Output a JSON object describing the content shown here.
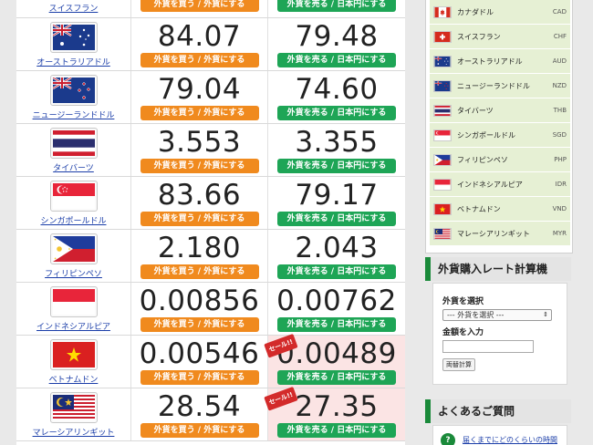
{
  "buttons": {
    "buy": "外貨を買う / 外貨にする",
    "sell": "外貨を売る / 日本円にする"
  },
  "sale_badge": "セール!!",
  "rates": [
    {
      "name": "スイスフラン",
      "flag": "switzerland-flag",
      "buy": "",
      "sell": ""
    },
    {
      "name": "オーストラリアドル",
      "flag": "australia-flag",
      "buy": "84.07",
      "sell": "79.48"
    },
    {
      "name": "ニュージーランドドル",
      "flag": "new-zealand-flag",
      "buy": "79.04",
      "sell": "74.60"
    },
    {
      "name": "タイバーツ",
      "flag": "thailand-flag",
      "buy": "3.553",
      "sell": "3.355"
    },
    {
      "name": "シンガポールドル",
      "flag": "singapore-flag",
      "buy": "83.66",
      "sell": "79.17"
    },
    {
      "name": "フィリピンペソ",
      "flag": "philippines-flag",
      "buy": "2.180",
      "sell": "2.043"
    },
    {
      "name": "インドネシアルピア",
      "flag": "indonesia-flag",
      "buy": "0.00856",
      "sell": "0.00762"
    },
    {
      "name": "ベトナムドン",
      "flag": "vietnam-flag",
      "buy": "0.00546",
      "sell": "0.00489"
    },
    {
      "name": "マレーシアリンギット",
      "flag": "malaysia-flag",
      "buy": "28.54",
      "sell": "27.35"
    }
  ],
  "sidebar": {
    "currencies": [
      {
        "name": "カナダドル",
        "code": "CAD",
        "flag": "canada-flag"
      },
      {
        "name": "スイスフラン",
        "code": "CHF",
        "flag": "switzerland-flag"
      },
      {
        "name": "オーストラリアドル",
        "code": "AUD",
        "flag": "australia-flag"
      },
      {
        "name": "ニュージーランドドル",
        "code": "NZD",
        "flag": "new-zealand-flag"
      },
      {
        "name": "タイバーツ",
        "code": "THB",
        "flag": "thailand-flag"
      },
      {
        "name": "シンガポールドル",
        "code": "SGD",
        "flag": "singapore-flag"
      },
      {
        "name": "フィリピンペソ",
        "code": "PHP",
        "flag": "philippines-flag"
      },
      {
        "name": "インドネシアルピア",
        "code": "IDR",
        "flag": "indonesia-flag"
      },
      {
        "name": "ベトナムドン",
        "code": "VND",
        "flag": "vietnam-flag"
      },
      {
        "name": "マレーシアリンギット",
        "code": "MYR",
        "flag": "malaysia-flag"
      }
    ],
    "calculator": {
      "title": "外貨購入レート計算機",
      "select_label": "外貨を選択",
      "select_value": "--- 外貨を選択 ---",
      "amount_label": "金額を入力",
      "amount_value": "",
      "submit": "両替計算"
    },
    "faq": {
      "title": "よくあるご質問",
      "first_question": "届くまでにどのくらいの時間"
    }
  },
  "colors": {
    "buy_button": "#f08a1e",
    "sell_button": "#1ea556",
    "sale_bg": "#fbe4e4",
    "sale_badge": "#d32a2a",
    "sidebar_item_bg": "#e6f0d4",
    "accent_green": "#1a8a3a",
    "link_blue": "#1a3da8"
  }
}
